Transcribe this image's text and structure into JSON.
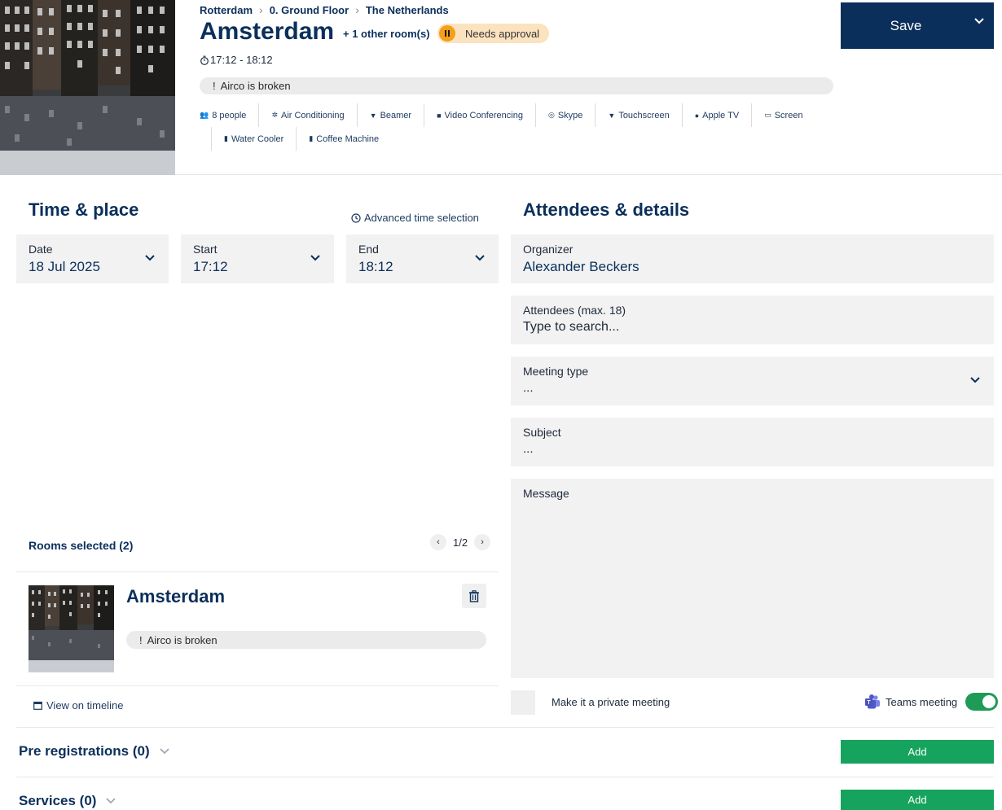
{
  "header": {
    "breadcrumb": [
      "Rotterdam",
      "0. Ground Floor",
      "The Netherlands"
    ],
    "title": "Amsterdam",
    "other_rooms": "+ 1 other room(s)",
    "status_badge": "Needs approval",
    "time_range": "17:12 - 18:12",
    "warning": "Airco is broken",
    "features_row1": [
      {
        "icon": "people-icon",
        "label": "8 people"
      },
      {
        "icon": "air-conditioning-icon",
        "label": "Air Conditioning"
      },
      {
        "icon": "beamer-icon",
        "label": "Beamer"
      },
      {
        "icon": "video-conferencing-icon",
        "label": "Video Conferencing"
      },
      {
        "icon": "skype-icon",
        "label": "Skype"
      },
      {
        "icon": "touchscreen-icon",
        "label": "Touchscreen"
      },
      {
        "icon": "apple-tv-icon",
        "label": "Apple TV"
      },
      {
        "icon": "screen-icon",
        "label": "Screen"
      }
    ],
    "features_row2": [
      {
        "icon": "water-cooler-icon",
        "label": "Water Cooler"
      },
      {
        "icon": "coffee-machine-icon",
        "label": "Coffee Machine"
      }
    ],
    "save_label": "Save"
  },
  "time_place": {
    "heading": "Time & place",
    "advanced_link": "Advanced time selection",
    "date": {
      "label": "Date",
      "value": "18 Jul 2025"
    },
    "start": {
      "label": "Start",
      "value": "17:12"
    },
    "end": {
      "label": "End",
      "value": "18:12"
    }
  },
  "rooms": {
    "heading": "Rooms selected (2)",
    "pager": "1/2",
    "room_name": "Amsterdam",
    "room_warning": "Airco is broken",
    "timeline_link": "View on timeline"
  },
  "details": {
    "heading": "Attendees & details",
    "organizer": {
      "label": "Organizer",
      "value": "Alexander Beckers"
    },
    "attendees": {
      "label": "Attendees (max. 18)",
      "placeholder": "Type to search..."
    },
    "meeting_type": {
      "label": "Meeting type",
      "value": "..."
    },
    "subject": {
      "label": "Subject",
      "value": "..."
    },
    "message": {
      "label": "Message"
    },
    "private_label": "Make it a private meeting",
    "teams_label": "Teams meeting",
    "teams_enabled": true
  },
  "sections": {
    "pre_registrations": {
      "title": "Pre registrations (0)",
      "add_label": "Add"
    },
    "services": {
      "title": "Services (0)",
      "add_label": "Add"
    }
  },
  "colors": {
    "primary": "#0b2f5b",
    "badge_bg": "#fbe3c0",
    "badge_icon": "#f59f1a",
    "add_button": "#16a35d",
    "toggle_on": "#1e9b57",
    "field_bg": "#f2f2f2"
  }
}
